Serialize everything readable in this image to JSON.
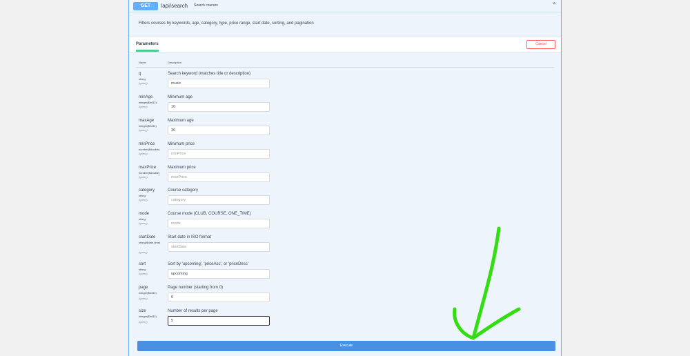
{
  "operation": {
    "method": "GET",
    "path": "/api/search",
    "summary": "Search courses",
    "description": "Filters courses by keywords, age, category, type, price range, start date, sorting, and pagination"
  },
  "tabs": {
    "parameters": "Parameters",
    "cancel": "Cancel"
  },
  "columns": {
    "name": "Name",
    "description": "Description"
  },
  "parameters": [
    {
      "name": "q",
      "type": "string",
      "in": "(query)",
      "description": "Search keyword (matches title or description)",
      "value": "music",
      "placeholder": ""
    },
    {
      "name": "minAge",
      "type": "integer($int32)",
      "in": "(query)",
      "description": "Minimum age",
      "value": "10",
      "placeholder": ""
    },
    {
      "name": "maxAge",
      "type": "integer($int32)",
      "in": "(query)",
      "description": "Maximum age",
      "value": "30",
      "placeholder": ""
    },
    {
      "name": "minPrice",
      "type": "number($double)",
      "in": "(query)",
      "description": "Minimum price",
      "value": "",
      "placeholder": "minPrice"
    },
    {
      "name": "maxPrice",
      "type": "number($double)",
      "in": "(query)",
      "description": "Maximum price",
      "value": "",
      "placeholder": "maxPrice"
    },
    {
      "name": "category",
      "type": "string",
      "in": "(query)",
      "description": "Course category",
      "value": "",
      "placeholder": "category"
    },
    {
      "name": "mode",
      "type": "string",
      "in": "(query)",
      "description": "Course mode (CLUB, COURSE, ONE_TIME)",
      "value": "",
      "placeholder": "mode"
    },
    {
      "name": "startDate",
      "type": "string($date-time)",
      "in": "(query)",
      "description": "Start date in ISO format",
      "value": "",
      "placeholder": "startDate"
    },
    {
      "name": "sort",
      "type": "string",
      "in": "(query)",
      "description": "Sort by 'upcoming', 'priceAsc', or 'priceDesc'",
      "value": "upcoming",
      "placeholder": ""
    },
    {
      "name": "page",
      "type": "integer($int32)",
      "in": "(query)",
      "description": "Page number (starting from 0)",
      "value": "0",
      "placeholder": ""
    },
    {
      "name": "size",
      "type": "integer($int32)",
      "in": "(query)",
      "description": "Number of results per page",
      "value": "5",
      "placeholder": ""
    }
  ],
  "execute_label": "Execute",
  "colors": {
    "accent": "#61affe",
    "execute": "#4990e2",
    "annotation_arrow": "#33dd11"
  }
}
